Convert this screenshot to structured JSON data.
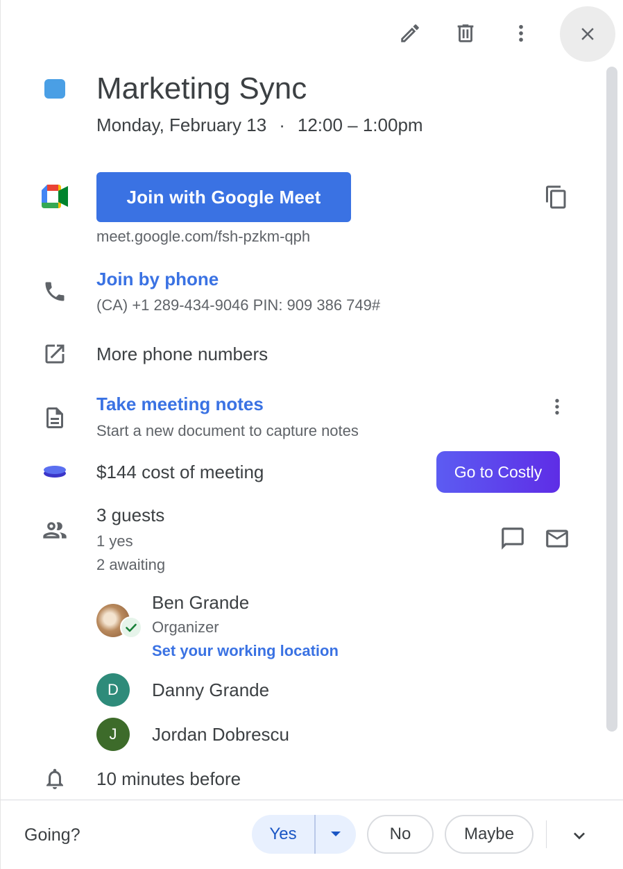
{
  "event": {
    "title": "Marketing Sync",
    "date": "Monday, February 13",
    "separator": "·",
    "time": "12:00 – 1:00pm",
    "color": "#4a9fe5"
  },
  "meet": {
    "button_label": "Join with Google Meet",
    "url": "meet.google.com/fsh-pzkm-qph"
  },
  "phone": {
    "title": "Join by phone",
    "details": "(CA) +1 289-434-9046 PIN: 909 386 749#"
  },
  "more_numbers": {
    "label": "More phone numbers"
  },
  "notes": {
    "title": "Take meeting notes",
    "subtitle": "Start a new document to capture notes"
  },
  "cost": {
    "label": "$144 cost of meeting",
    "button_label": "Go to Costly"
  },
  "guests": {
    "count_label": "3 guests",
    "yes_label": "1 yes",
    "awaiting_label": "2 awaiting",
    "list": [
      {
        "name": "Ben Grande",
        "role": "Organizer",
        "link": "Set your working location"
      },
      {
        "name": "Danny Grande",
        "initial": "D",
        "color": "#2e8b7a"
      },
      {
        "name": "Jordan Dobrescu",
        "initial": "J",
        "color": "#3d6b2a"
      }
    ]
  },
  "reminder": {
    "label": "10 minutes before"
  },
  "footer": {
    "going_label": "Going?",
    "yes": "Yes",
    "no": "No",
    "maybe": "Maybe"
  },
  "colors": {
    "accent": "#3a72e3",
    "costly_gradient_start": "#5c5cf2",
    "costly_gradient_end": "#5e2de6"
  }
}
